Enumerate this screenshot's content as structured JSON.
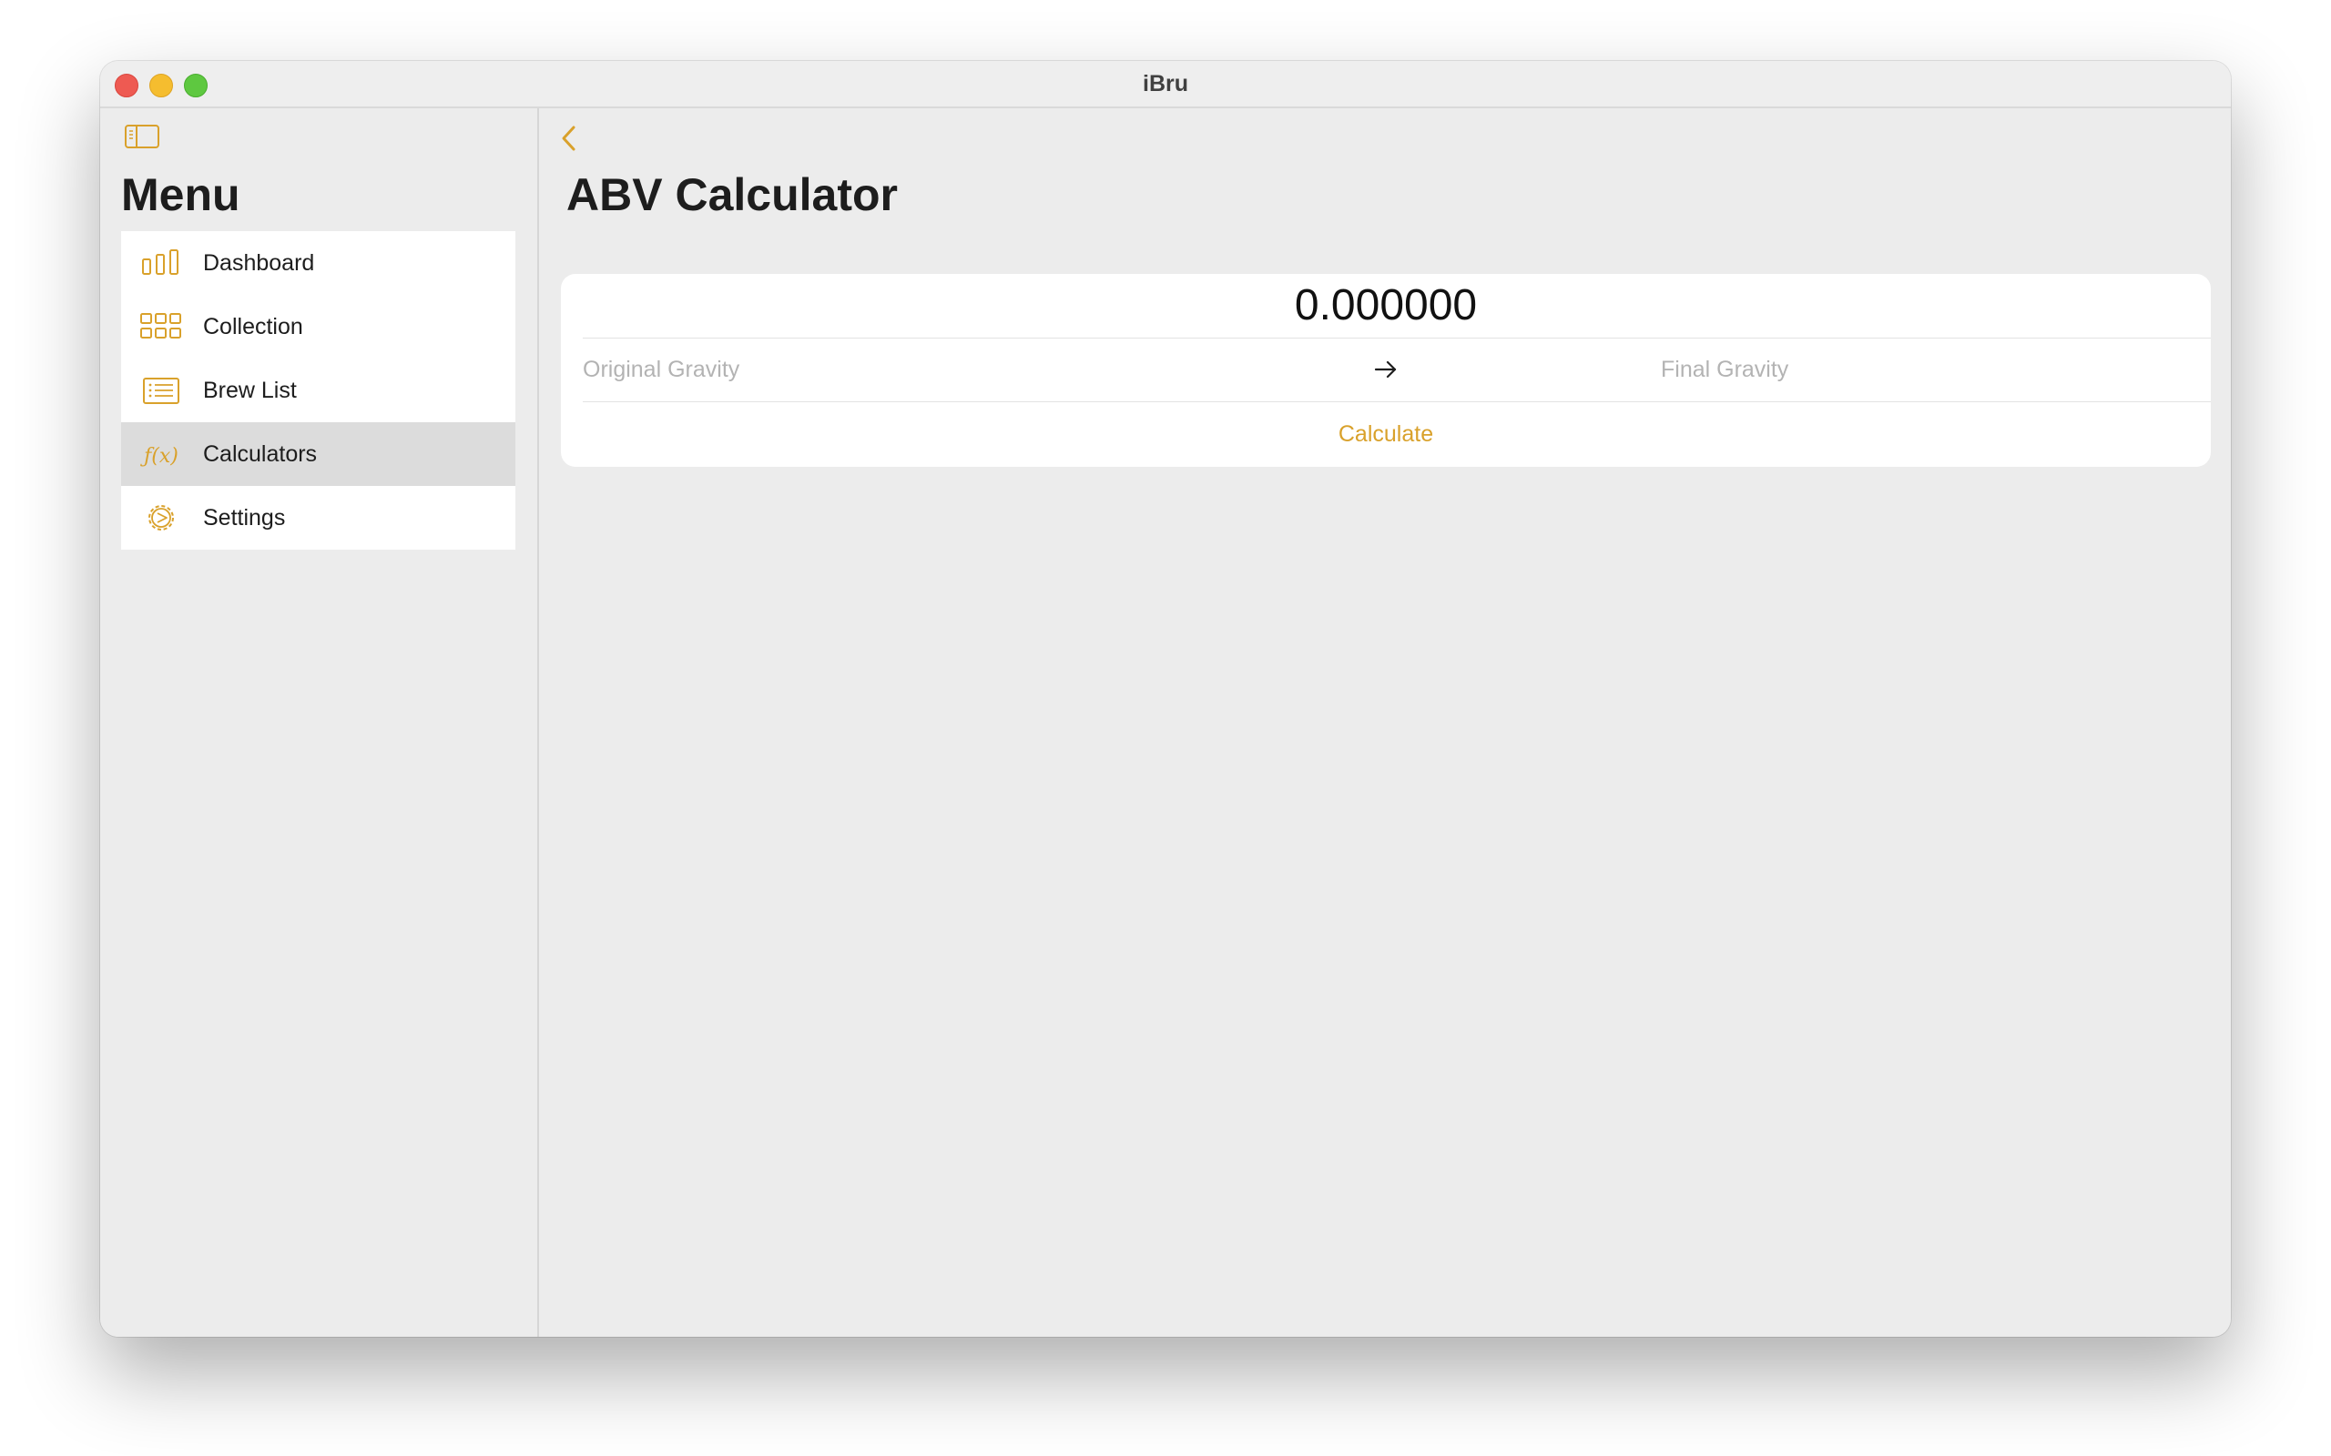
{
  "window": {
    "title": "iBru"
  },
  "sidebar": {
    "title": "Menu",
    "items": [
      {
        "label": "Dashboard",
        "icon": "bar-chart-icon",
        "selected": false
      },
      {
        "label": "Collection",
        "icon": "grid-icon",
        "selected": false
      },
      {
        "label": "Brew List",
        "icon": "list-icon",
        "selected": false
      },
      {
        "label": "Calculators",
        "icon": "function-icon",
        "selected": true
      },
      {
        "label": "Settings",
        "icon": "gear-icon",
        "selected": false
      }
    ]
  },
  "main": {
    "title": "ABV Calculator",
    "result": "0.000000",
    "original_gravity": {
      "value": "",
      "placeholder": "Original Gravity"
    },
    "final_gravity": {
      "value": "",
      "placeholder": "Final Gravity"
    },
    "calculate_label": "Calculate"
  },
  "colors": {
    "accent": "#d9a12b",
    "background": "#ececec",
    "card": "#ffffff",
    "selected": "#dcdcdc"
  }
}
